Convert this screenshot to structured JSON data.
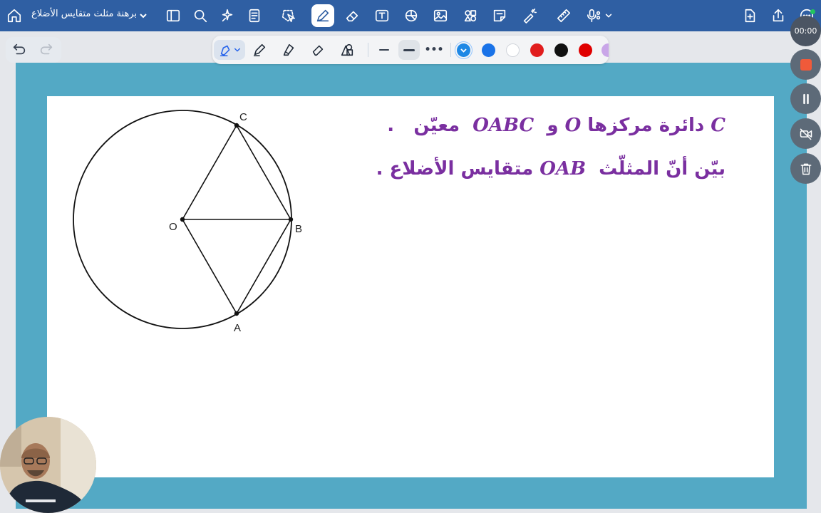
{
  "app": {
    "document_title": "برهنة مثلث متقايس الأضلاع",
    "icons": {
      "home": "home-icon",
      "sidebar": "sidebar-icon",
      "search": "search-icon",
      "ai": "sparkle-icon",
      "notes": "document-icon",
      "lasso": "lasso-icon",
      "pen": "pen-icon",
      "eraser": "eraser-icon",
      "text": "text-icon",
      "shapes": "shapes-icon",
      "image": "image-icon",
      "elements": "elements-icon",
      "sticky": "sticky-note-icon",
      "laser": "laser-pointer-icon",
      "ruler": "ruler-icon",
      "audio": "microphone-icon",
      "add_page": "add-page-icon",
      "share": "share-icon",
      "more": "more-icon"
    }
  },
  "pen_toolbar": {
    "tools": [
      "fountain-pen",
      "ball-pen",
      "highlighter",
      "eraser",
      "shapes"
    ],
    "colors": [
      "#1e88e5",
      "#1a73e8",
      "#ffffff",
      "#e11d1d",
      "#111111",
      "#e00000",
      "#c9a6e8"
    ],
    "selected_color": "#1e88e5",
    "accent": "#2563eb"
  },
  "recording": {
    "time": "00:00",
    "stop_color": "#f05a3a"
  },
  "problem": {
    "line1_part1": "دائرة مركزها",
    "line1_c": "C",
    "line1_o": "O",
    "line1_and": "و",
    "line1_oabc": "OABC",
    "line1_part2": "معيّن",
    "line1_end": ".",
    "line2_part1": "بيّن أنّ المثلّث",
    "line2_oab": "OAB",
    "line2_part2": "متقايس الأضلاع",
    "line2_end": ".",
    "text_color": "#7a2fa0"
  },
  "figure": {
    "points": {
      "O": "O",
      "A": "A",
      "B": "B",
      "C": "C"
    }
  }
}
